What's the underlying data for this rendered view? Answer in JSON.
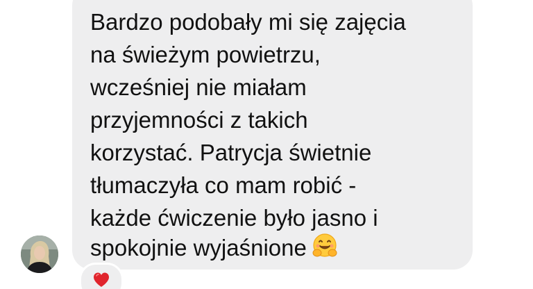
{
  "message": {
    "lines": [
      "Bardzo podobały mi się zajęcia",
      "na świeżym powietrzu,",
      "wcześniej nie miałam",
      "przyjemności z takich",
      "korzystać. Patrycja świetnie",
      "tłumaczyła co mam robić -",
      "każde ćwiczenie było jasno i",
      "spokojnie wyjaśnione"
    ],
    "trailing_emoji": "hugging-face-icon"
  },
  "reaction": {
    "icon": "red-heart-icon",
    "color": "#e0242c"
  },
  "sender": {
    "avatar_icon": "profile-photo"
  },
  "colors": {
    "bubble": "#eeeeef",
    "text": "#111111"
  }
}
